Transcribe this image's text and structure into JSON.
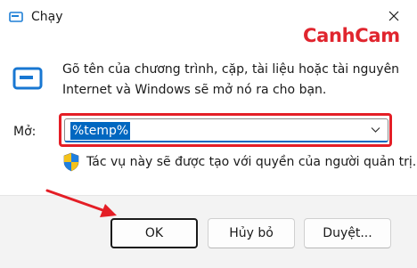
{
  "window": {
    "title": "Chạy",
    "close_glyph": "✕"
  },
  "watermark": "CanhCam",
  "description": {
    "line1": "Gõ tên của chương trình, cặp, tài liệu hoặc tài nguyên",
    "line2": "Internet và Windows sẽ mở nó ra cho bạn."
  },
  "open_field": {
    "label": "Mở:",
    "value": "%temp%"
  },
  "admin_note": "Tác vụ này sẽ được tạo với quyền của người quản trị.",
  "buttons": {
    "ok": "OK",
    "cancel": "Hủy bỏ",
    "browse": "Duyệt..."
  },
  "colors": {
    "accent": "#0067c0",
    "annotation_red": "#e41e26",
    "watermark_red": "#e0252e"
  },
  "icons": {
    "title": "run-icon",
    "app": "run-app-icon",
    "shield": "uac-shield-icon",
    "dropdown": "chevron-down-icon",
    "close": "close-icon"
  }
}
